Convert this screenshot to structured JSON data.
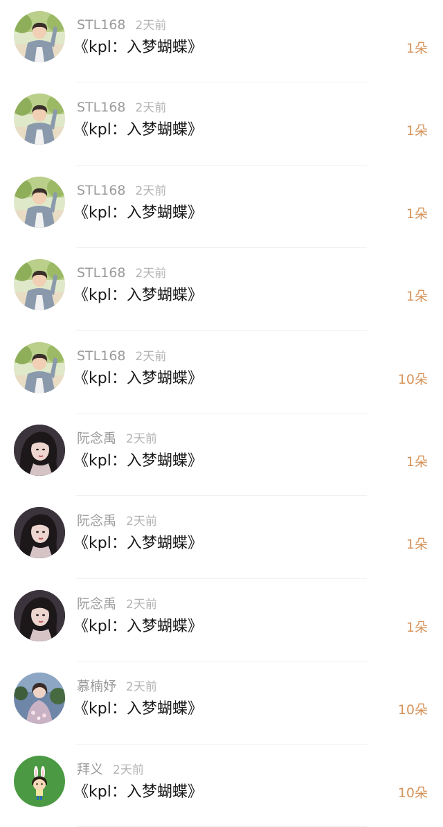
{
  "colors": {
    "count_text": "#d6935a",
    "username_text": "#9a9a9a",
    "title_text": "#1a1a1a",
    "divider": "#f1f1f1"
  },
  "rows": [
    {
      "user": "STL168",
      "time": "2天前",
      "title": "《kpl：入梦蝴蝶》",
      "count": "1朵",
      "avatar": "boy-photo"
    },
    {
      "user": "STL168",
      "time": "2天前",
      "title": "《kpl：入梦蝴蝶》",
      "count": "1朵",
      "avatar": "boy-photo"
    },
    {
      "user": "STL168",
      "time": "2天前",
      "title": "《kpl：入梦蝴蝶》",
      "count": "1朵",
      "avatar": "boy-photo"
    },
    {
      "user": "STL168",
      "time": "2天前",
      "title": "《kpl：入梦蝴蝶》",
      "count": "1朵",
      "avatar": "boy-photo"
    },
    {
      "user": "STL168",
      "time": "2天前",
      "title": "《kpl：入梦蝴蝶》",
      "count": "10朵",
      "avatar": "boy-photo"
    },
    {
      "user": "阮念禹",
      "time": "2天前",
      "title": "《kpl：入梦蝴蝶》",
      "count": "1朵",
      "avatar": "girl-dark-hair-photo"
    },
    {
      "user": "阮念禹",
      "time": "2天前",
      "title": "《kpl：入梦蝴蝶》",
      "count": "1朵",
      "avatar": "girl-dark-hair-photo"
    },
    {
      "user": "阮念禹",
      "time": "2天前",
      "title": "《kpl：入梦蝴蝶》",
      "count": "1朵",
      "avatar": "girl-dark-hair-photo"
    },
    {
      "user": "慕楠妤",
      "time": "2天前",
      "title": "《kpl：入梦蝴蝶》",
      "count": "10朵",
      "avatar": "girl-flowers-photo"
    },
    {
      "user": "拜义",
      "time": "2天前",
      "title": "《kpl：入梦蝴蝶》",
      "count": "10朵",
      "avatar": "cartoon-bunny-girl"
    }
  ]
}
